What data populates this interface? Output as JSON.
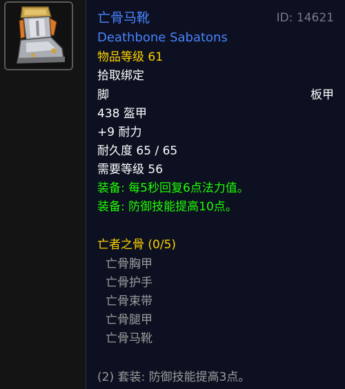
{
  "item": {
    "name_cn": "亡骨马靴",
    "name_en": "Deathbone Sabatons",
    "id_label": "ID: 14621",
    "item_level": "物品等级 61",
    "bind": "拾取绑定",
    "slot": "脚",
    "armor_type": "板甲",
    "armor": "438 盔甲",
    "stamina": "+9 耐力",
    "durability": "耐久度 65 / 65",
    "required_level": "需要等级 56",
    "equip_effects": [
      "装备: 每5秒回复6点法力值。",
      "装备: 防御技能提高10点。"
    ],
    "icon": "plate-boots-icon"
  },
  "set": {
    "name": "亡者之骨 (0/5)",
    "pieces": [
      "亡骨胸甲",
      "亡骨护手",
      "亡骨束带",
      "亡骨腿甲",
      "亡骨马靴"
    ],
    "bonus": "(2) 套装: 防御技能提高3点。"
  },
  "colors": {
    "epic_name": "#4a83ff",
    "item_level": "#ffd200",
    "equip_green": "#1eff00",
    "set_gold": "#ffd200",
    "set_inactive": "#9d9d9d",
    "background": "#0c1020"
  }
}
